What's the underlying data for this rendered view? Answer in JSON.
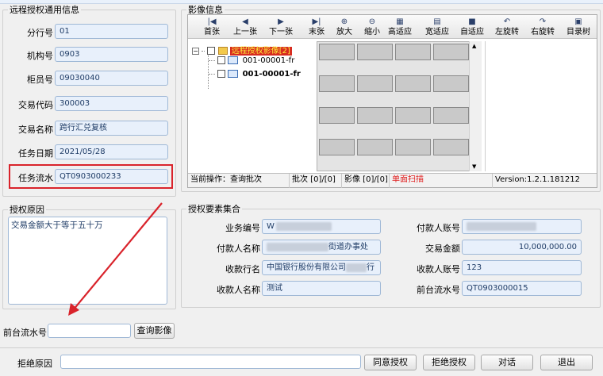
{
  "left_info": {
    "legend": "远程授权通用信息",
    "fields": [
      {
        "label": "分行号",
        "value": "01"
      },
      {
        "label": "机构号",
        "value": "0903"
      },
      {
        "label": "柜员号",
        "value": "09030040"
      },
      {
        "label": "交易代码",
        "value": "300003"
      },
      {
        "label": "交易名称",
        "value": "跨行汇兑复核"
      },
      {
        "label": "任务日期",
        "value": "2021/05/28"
      },
      {
        "label": "任务流水",
        "value": "QT0903000233"
      }
    ]
  },
  "reason": {
    "legend": "授权原因",
    "text": "交易金额大于等于五十万"
  },
  "front_serial": {
    "label": "前台流水号",
    "value": "",
    "query_button": "查询影像"
  },
  "image_info": {
    "legend": "影像信息",
    "toolbar": [
      {
        "icon": "first-page-icon",
        "glyph": "|◀",
        "label": "首张"
      },
      {
        "icon": "prev-page-icon",
        "glyph": "◀",
        "label": "上一张"
      },
      {
        "icon": "next-page-icon",
        "glyph": "▶",
        "label": "下一张"
      },
      {
        "icon": "last-page-icon",
        "glyph": "▶|",
        "label": "末张"
      },
      {
        "icon": "zoom-in-icon",
        "glyph": "⊕",
        "label": "放大"
      },
      {
        "icon": "zoom-out-icon",
        "glyph": "⊖",
        "label": "缩小"
      },
      {
        "icon": "fit-height-icon",
        "glyph": "▦",
        "label": "高适应"
      },
      {
        "icon": "fit-width-icon",
        "glyph": "▤",
        "label": "宽适应"
      },
      {
        "icon": "auto-fit-icon",
        "glyph": "■",
        "label": "自适应"
      },
      {
        "icon": "rotate-left-icon",
        "glyph": "↶",
        "label": "左旋转"
      },
      {
        "icon": "rotate-right-icon",
        "glyph": "↷",
        "label": "右旋转"
      },
      {
        "icon": "directory-tree-icon",
        "glyph": "▣",
        "label": "目录树"
      }
    ],
    "tree": {
      "root": "远程授权影像[2]",
      "children": [
        "001-00001-fr",
        "001-00001-fr"
      ]
    },
    "status": {
      "operation": "当前操作：查询批次",
      "batch": "批次 [0]/[0]",
      "image": "影像 [0]/[0]",
      "scan": "单面扫描",
      "version": "Version:1.2.1.181212"
    }
  },
  "elements": {
    "legend": "授权要素集合",
    "left": [
      {
        "label": "业务编号",
        "value": "W"
      },
      {
        "label": "付款人名称",
        "value": "街道办事处"
      },
      {
        "label": "收款行名",
        "value": "中国银行股份有限公司",
        "suffix": "行"
      },
      {
        "label": "收款人名称",
        "value": "测试"
      }
    ],
    "right": [
      {
        "label": "付款人账号",
        "value": ""
      },
      {
        "label": "交易金额",
        "value": "10,000,000.00"
      },
      {
        "label": "收款人账号",
        "value": "123"
      },
      {
        "label": "前台流水号",
        "value": "QT0903000015"
      }
    ]
  },
  "bottom": {
    "reject_label": "拒绝原因",
    "reject_value": "",
    "approve": "同意授权",
    "reject": "拒绝授权",
    "dialog": "对话",
    "exit": "退出"
  },
  "colors": {
    "highlight": "#d9232b",
    "scan_text": "#e02020",
    "tree_root_bg": "#d72b20"
  }
}
